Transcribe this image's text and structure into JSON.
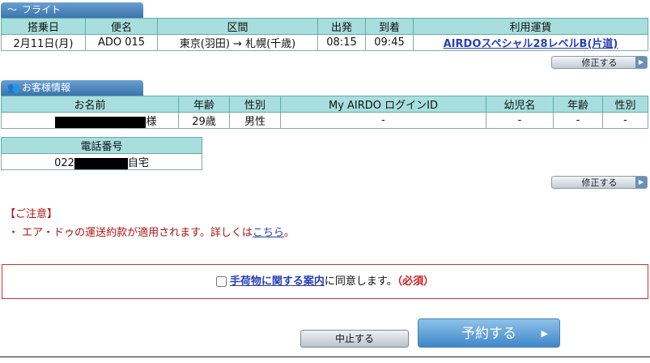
{
  "flight": {
    "tab_label": "フライト",
    "headers": [
      "搭乗日",
      "便名",
      "区間",
      "出発",
      "到着",
      "利用運賃"
    ],
    "row": {
      "date": "2月11日(月)",
      "flight_no": "ADO 015",
      "route": "東京(羽田) → 札幌(千歳)",
      "depart": "08:15",
      "arrive": "09:45",
      "fare": "AIRDOスペシャル28レベルB(片道)"
    },
    "edit_label": "修正する"
  },
  "customer": {
    "tab_label": "お客様情報",
    "headers": [
      "お名前",
      "年齢",
      "性別",
      "My AIRDO ログインID",
      "幼児名",
      "年齢",
      "性別"
    ],
    "row": {
      "name_suffix": "様",
      "age": "29歳",
      "gender": "男性",
      "login_id": "-",
      "infant_name": "-",
      "infant_age": "-",
      "infant_gender": "-"
    },
    "phone_header": "電話番号",
    "phone_prefix": "022",
    "phone_type": "自宅",
    "edit_label": "修正する"
  },
  "notice": {
    "title": "【ご注意】",
    "text_prefix": "・ エア・ドゥの運送約款が適用されます。詳しくは",
    "link": "こちら",
    "text_suffix": "。"
  },
  "agree": {
    "link": "手荷物に関する案内",
    "text": "に同意します。",
    "required": "（必須）",
    "checked": false
  },
  "buttons": {
    "cancel": "中止する",
    "reserve": "予約する"
  }
}
